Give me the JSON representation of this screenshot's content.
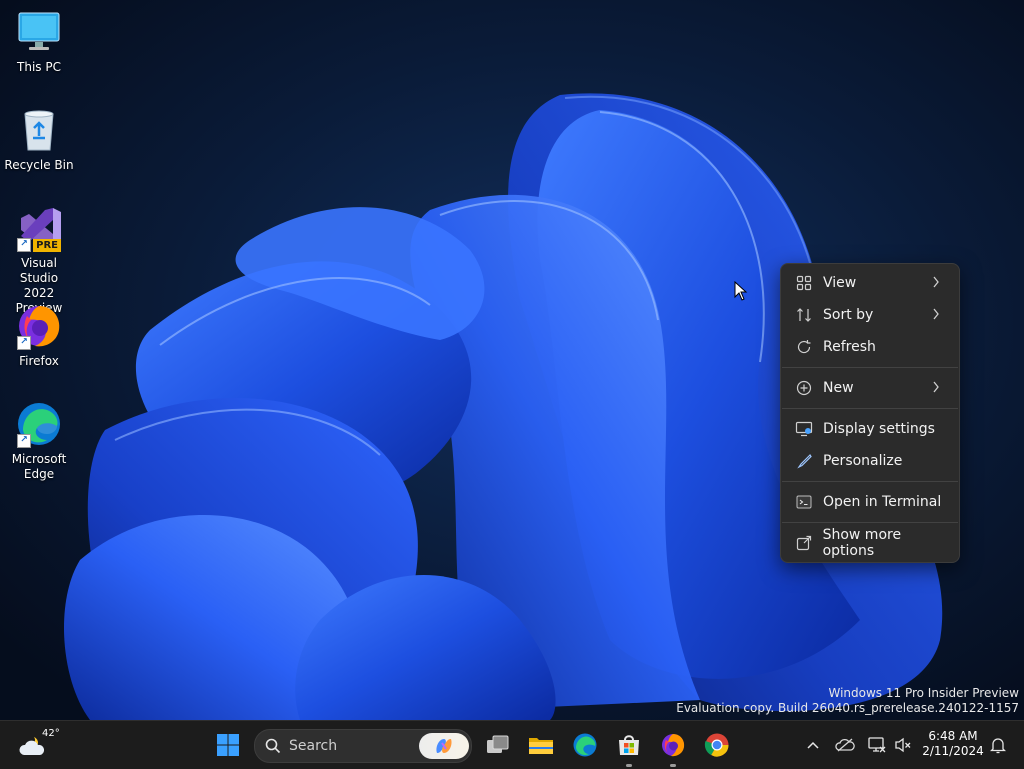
{
  "desktop": {
    "icons": [
      {
        "label": "This PC",
        "icon": "monitor-icon"
      },
      {
        "label": "Recycle Bin",
        "icon": "recycle-bin-icon"
      },
      {
        "label": "Visual Studio\n2022 Preview",
        "label_line1": "Visual Studio",
        "label_line2": "2022 Preview",
        "badge": "PRE",
        "icon": "visual-studio-icon"
      },
      {
        "label": "Firefox",
        "icon": "firefox-icon"
      },
      {
        "label_line1": "Microsoft",
        "label_line2": "Edge",
        "icon": "edge-icon"
      }
    ]
  },
  "context_menu": {
    "items": [
      {
        "label": "View",
        "icon": "grid-icon",
        "submenu": true
      },
      {
        "label": "Sort by",
        "icon": "sort-icon",
        "submenu": true
      },
      {
        "label": "Refresh",
        "icon": "refresh-icon",
        "submenu": false
      },
      {
        "label": "New",
        "icon": "plus-circle-icon",
        "submenu": true
      },
      {
        "label": "Display settings",
        "icon": "display-icon",
        "submenu": false
      },
      {
        "label": "Personalize",
        "icon": "brush-icon",
        "submenu": false
      },
      {
        "label": "Open in Terminal",
        "icon": "terminal-icon",
        "submenu": false
      },
      {
        "label": "Show more options",
        "icon": "share-icon",
        "submenu": false
      }
    ]
  },
  "watermark": {
    "line1": "Windows 11 Pro Insider Preview",
    "line2": "Evaluation copy. Build 26040.rs_prerelease.240122-1157"
  },
  "taskbar": {
    "weather_temp": "42°",
    "search_placeholder": "Search",
    "clock_time": "6:48 AM",
    "clock_date": "2/11/2024",
    "apps": [
      "start-icon",
      "search-icon",
      "copilot-icon",
      "task-view-icon",
      "file-explorer-icon",
      "edge-icon",
      "store-icon",
      "firefox-icon",
      "chrome-icon"
    ],
    "tray": [
      "chevron-up-icon",
      "onedrive-icon",
      "network-icon",
      "volume-muted-icon",
      "notification-bell-icon"
    ]
  },
  "colors": {
    "menu_bg": "#2b2b2b",
    "taskbar_bg": "#1c1c1c",
    "wallpaper_bloom": "#1f55e0",
    "wallpaper_bg": "#071226"
  }
}
